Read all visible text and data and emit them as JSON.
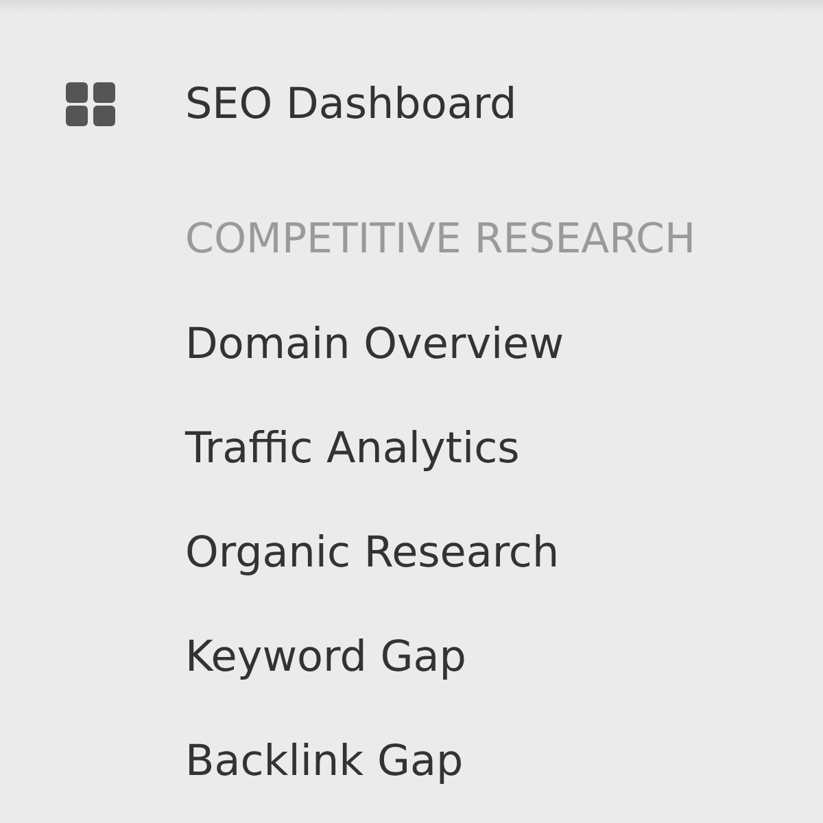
{
  "sidebar": {
    "top_item": {
      "label": "SEO Dashboard"
    },
    "section": {
      "heading": "COMPETITIVE RESEARCH",
      "items": [
        {
          "label": "Domain Overview"
        },
        {
          "label": "Traffic Analytics"
        },
        {
          "label": "Organic Research"
        },
        {
          "label": "Keyword Gap"
        },
        {
          "label": "Backlink Gap"
        }
      ]
    }
  }
}
